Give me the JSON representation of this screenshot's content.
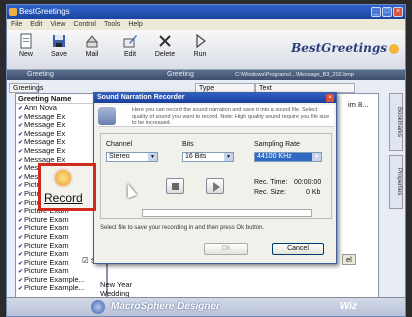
{
  "window": {
    "title": "BestGreetings"
  },
  "menu": [
    "File",
    "Edit",
    "View",
    "Control",
    "Tools",
    "Help"
  ],
  "toolbar": {
    "buttons": [
      {
        "label": "New",
        "icon": "new-doc-icon"
      },
      {
        "label": "Save",
        "icon": "floppy-icon"
      },
      {
        "label": "Mail",
        "icon": "mail-icon"
      },
      {
        "label": "Edit",
        "icon": "edit-icon"
      },
      {
        "label": "Delete",
        "icon": "delete-icon"
      },
      {
        "label": "Run",
        "icon": "run-icon"
      }
    ],
    "brand": "BestGreetings"
  },
  "tabs": {
    "first": "Greeting",
    "second": "Greeting",
    "path": "C:\\Windows\\Programs\\...\\Message_B3_202.bmp"
  },
  "columns": {
    "greetings": "Greetings",
    "type": "Type",
    "text": "Text"
  },
  "left_list": {
    "header": "Greeting Name",
    "items": [
      "Ann Nova",
      "Message Ex",
      "Message Ex",
      "Message Ex",
      "Message Ex",
      "Message Ex",
      "Message Ex",
      "Message Ex",
      "Message Ex",
      "Picture Exam",
      "Picture Exam",
      "Picture Exam",
      "Picture Exam",
      "Picture Exam",
      "Picture Exam",
      "Picture Exam",
      "Picture Exam",
      "Picture Exam",
      "Picture Exam",
      "Picture Exam",
      "Picture Example...",
      "Picture Example..."
    ]
  },
  "right_col": {
    "rows": [
      {
        "type": "New Year"
      },
      {
        "type": "Wedding"
      }
    ],
    "checkbox_label": "Sh",
    "cancel_fragment": "el",
    "tail_text": "im 8..."
  },
  "side_tabs": [
    "Bookmarks",
    "Properties"
  ],
  "dialog": {
    "title": "Sound Narration Recorder",
    "description": "Here you can record the sound narration and save it into a sound file. Select quality of sound you want to record. Note: High quality sound require you file size to be increased.",
    "channel_label": "Channel",
    "channel_value": "Stereo",
    "bits_label": "Bits",
    "bits_value": "16 Bits",
    "rate_label": "Sampling Rate",
    "rate_value": "44100 KHz",
    "rec_time_label": "Rec. Time:",
    "rec_time_value": "00:00:00",
    "rec_size_label": "Rec. Size:",
    "rec_size_value": "0 Kb",
    "record_label": "Record",
    "info": "Select file to save your recording in and then press Ok button.",
    "ok_label": "Ok",
    "cancel_label": "Cancel"
  },
  "footer": {
    "product": "MacroSphere Designer",
    "wiz": "Wiz"
  }
}
